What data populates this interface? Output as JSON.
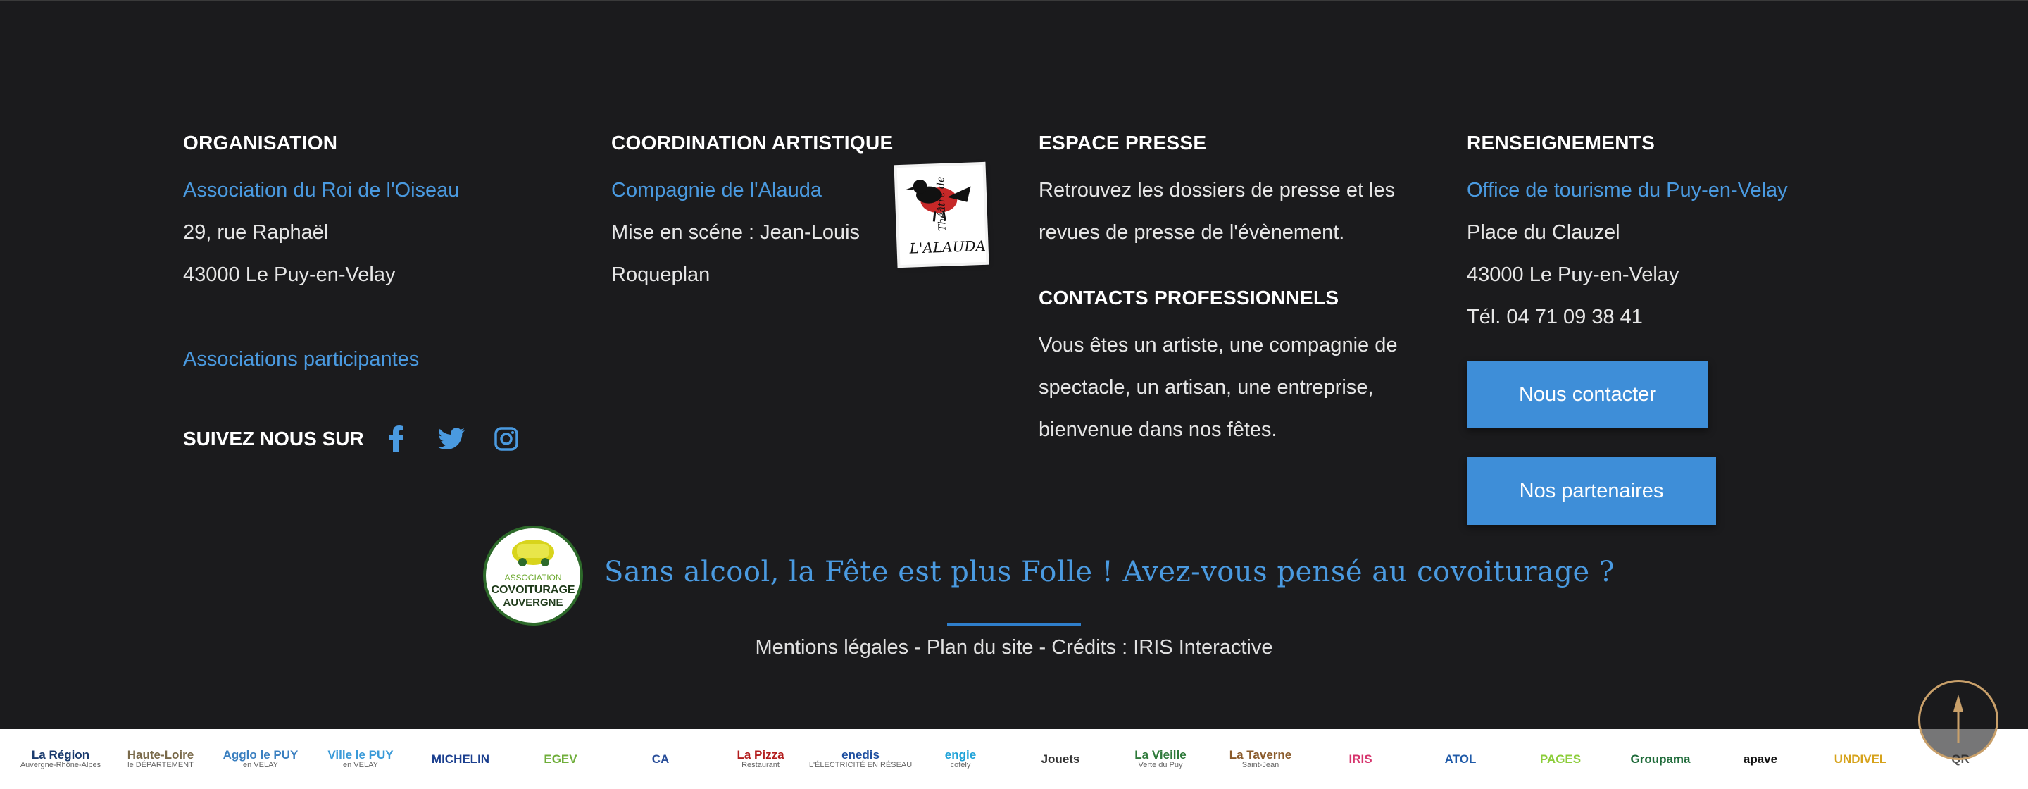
{
  "organisation": {
    "heading": "ORGANISATION",
    "org_link": "Association du Roi de l'Oiseau",
    "address1": "29, rue Raphaël",
    "address2": "43000 Le Puy-en-Velay",
    "participants_link": "Associations participantes"
  },
  "coordination": {
    "heading": "COORDINATION ARTISTIQUE",
    "company_link": "Compagnie de l'Alauda",
    "line1": "Mise en scéne : Jean-Louis",
    "line2": "Roqueplan",
    "logo_text1": "Théâtre de",
    "logo_text2": "L'ALAUDA"
  },
  "presse": {
    "heading": "ESPACE PRESSE",
    "line1": "Retrouvez les dossiers de presse et les",
    "line2": "revues de presse de l'évènement."
  },
  "contacts": {
    "heading": "CONTACTS PROFESSIONNELS",
    "line1": "Vous êtes un artiste, une compagnie de",
    "line2": "spectacle, un artisan, une entreprise,",
    "line3": "bienvenue dans nos fêtes."
  },
  "renseignements": {
    "heading": "RENSEIGNEMENTS",
    "office_link": "Office de tourisme du Puy-en-Velay",
    "address1": "Place du Clauzel",
    "address2": "43000 Le Puy-en-Velay",
    "phone": "Tél. 04 71 09 38 41"
  },
  "buttons": {
    "contact": "Nous contacter",
    "partners": "Nos partenaires"
  },
  "social": {
    "label": "SUIVEZ NOUS SUR",
    "icons": [
      "facebook-icon",
      "twitter-icon",
      "instagram-icon"
    ]
  },
  "covoiturage": {
    "badge_line1": "ASSOCIATION",
    "badge_line2": "COVOITURAGE",
    "badge_line3": "AUVERGNE",
    "tagline": "Sans alcool, la Fête est plus Folle ! Avez-vous pensé au covoiturage ?"
  },
  "legal": {
    "text": "Mentions légales - Plan du site - Crédits : IRIS Interactive"
  },
  "partners": [
    {
      "name": "La Région",
      "sub": "Auvergne-Rhône-Alpes",
      "color": "#1a3b6e"
    },
    {
      "name": "Haute-Loire",
      "sub": "le DÉPARTEMENT",
      "color": "#7a6a4a"
    },
    {
      "name": "Agglo le PUY",
      "sub": "en VELAY",
      "color": "#3a7fc0"
    },
    {
      "name": "Ville le PUY",
      "sub": "en VELAY",
      "color": "#3a9ad8"
    },
    {
      "name": "MICHELIN",
      "sub": "",
      "color": "#1b3f8f"
    },
    {
      "name": "EGEV",
      "sub": "",
      "color": "#6fae3a"
    },
    {
      "name": "CA",
      "sub": "",
      "color": "#2a4f9a"
    },
    {
      "name": "La Pizza",
      "sub": "Restaurant",
      "color": "#b31d1d"
    },
    {
      "name": "enedis",
      "sub": "L'ÉLECTRICITÉ EN RÉSEAU",
      "color": "#1e4fa0"
    },
    {
      "name": "engie",
      "sub": "cofely",
      "color": "#1ea2d8"
    },
    {
      "name": "Jouets",
      "sub": "",
      "color": "#333333"
    },
    {
      "name": "La Vieille",
      "sub": "Verte du Puy",
      "color": "#2e7a3a"
    },
    {
      "name": "La Taverne",
      "sub": "Saint-Jean",
      "color": "#8a5a2a"
    },
    {
      "name": "IRIS",
      "sub": "",
      "color": "#d6336c"
    },
    {
      "name": "ATOL",
      "sub": "",
      "color": "#1f5aa8"
    },
    {
      "name": "PAGES",
      "sub": "",
      "color": "#8ccd3a"
    },
    {
      "name": "Groupama",
      "sub": "",
      "color": "#1f6b3a"
    },
    {
      "name": "apave",
      "sub": "",
      "color": "#111111"
    },
    {
      "name": "UNDIVEL",
      "sub": "",
      "color": "#d6a21a"
    },
    {
      "name": "QR",
      "sub": "",
      "color": "#555555"
    }
  ],
  "colors": {
    "background": "#1b1b1d",
    "accent": "#4a9ae0",
    "button": "#3e8ed8",
    "scroll_ring": "#c9a06a"
  }
}
